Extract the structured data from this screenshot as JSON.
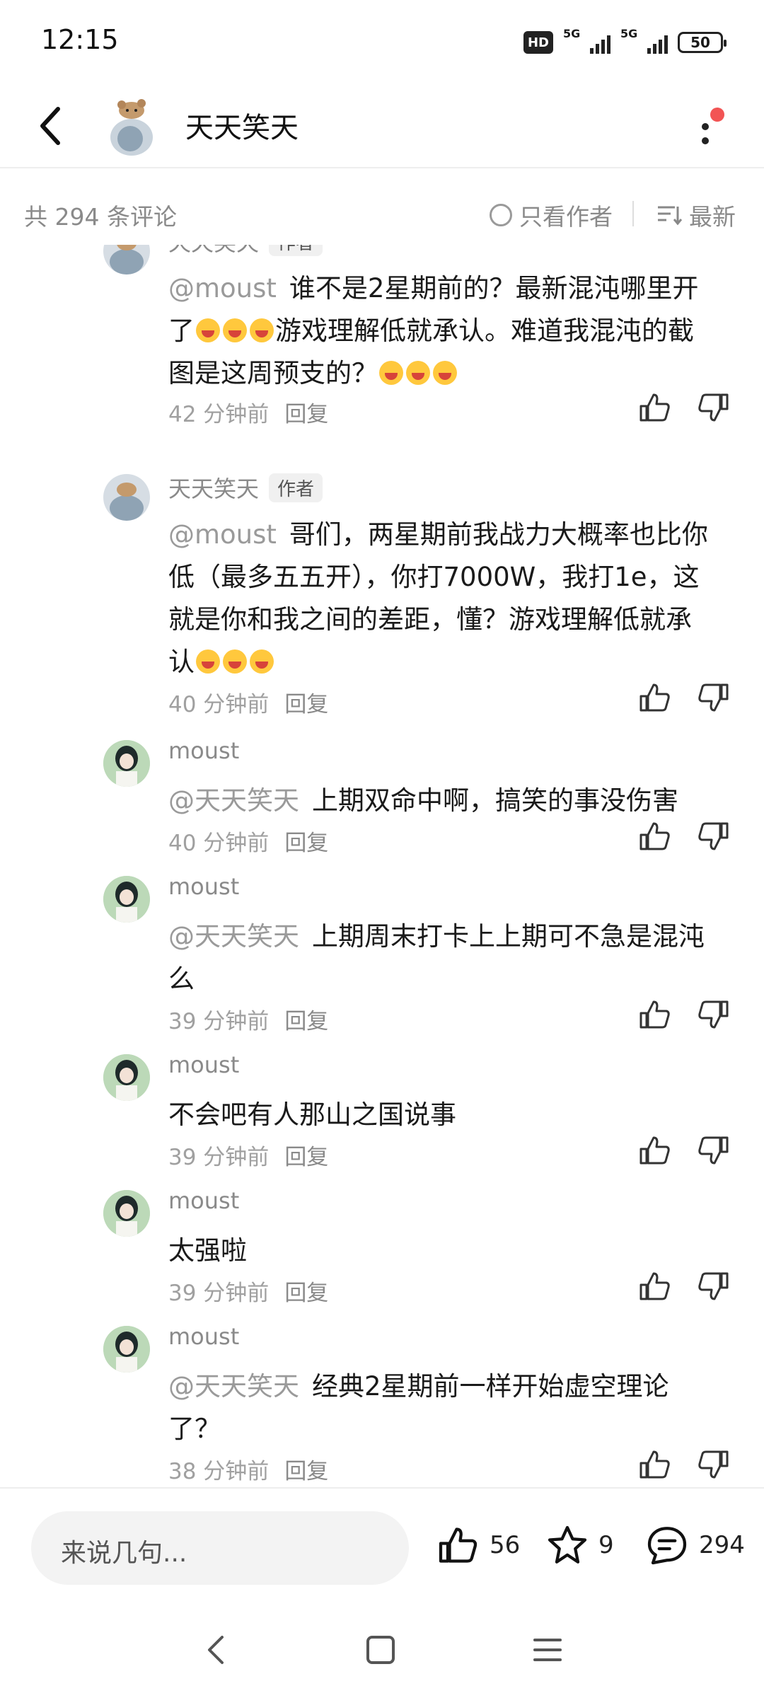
{
  "status_bar": {
    "time": "12:15",
    "hd_label": "HD",
    "network_1": "5G",
    "network_2": "5G",
    "battery": "50"
  },
  "header": {
    "title": "天天笑天",
    "back_icon": "chevron-left-icon",
    "more_icon": "more-vertical-icon",
    "notify_color": "#f25454"
  },
  "comment_bar": {
    "count_text": "共 294 条评论",
    "only_author": "只看作者",
    "sort_label": "最新"
  },
  "comments": [
    {
      "name": "天天笑天",
      "tag": "作者",
      "mention": "@moust",
      "lines": [
        "谁不是2星期前的？最新混沌哪里开",
        "了",
        "游戏理解低就承认。难道我混沌的截",
        "图是这周预支的？"
      ],
      "time": "42 分钟前",
      "reply": "回复"
    },
    {
      "name": "天天笑天",
      "tag": "作者",
      "mention": "@moust",
      "lines": [
        "哥们，两星期前我战力大概率也比你",
        "低（最多五五开），你打7000W，我打1e，这",
        "就是你和我之间的差距，懂？游戏理解低就承",
        "认"
      ],
      "time": "40 分钟前",
      "reply": "回复"
    },
    {
      "name": "moust",
      "mention": "@天天笑天",
      "lines": [
        "上期双命中啊，搞笑的事没伤害"
      ],
      "time": "40 分钟前",
      "reply": "回复"
    },
    {
      "name": "moust",
      "mention": "@天天笑天",
      "lines": [
        "上期周末打卡上上期可不急是混沌",
        "么"
      ],
      "time": "39 分钟前",
      "reply": "回复"
    },
    {
      "name": "moust",
      "lines": [
        "不会吧有人那山之国说事"
      ],
      "time": "39 分钟前",
      "reply": "回复"
    },
    {
      "name": "moust",
      "lines": [
        "太强啦"
      ],
      "time": "39 分钟前",
      "reply": "回复"
    },
    {
      "name": "moust",
      "mention": "@天天笑天",
      "lines": [
        "经典2星期前一样开始虚空理论",
        "了？"
      ],
      "time": "38 分钟前",
      "reply": "回复"
    }
  ],
  "bottom_bar": {
    "input_placeholder": "来说几句...",
    "likes": "56",
    "favorites": "9",
    "comments": "294"
  }
}
